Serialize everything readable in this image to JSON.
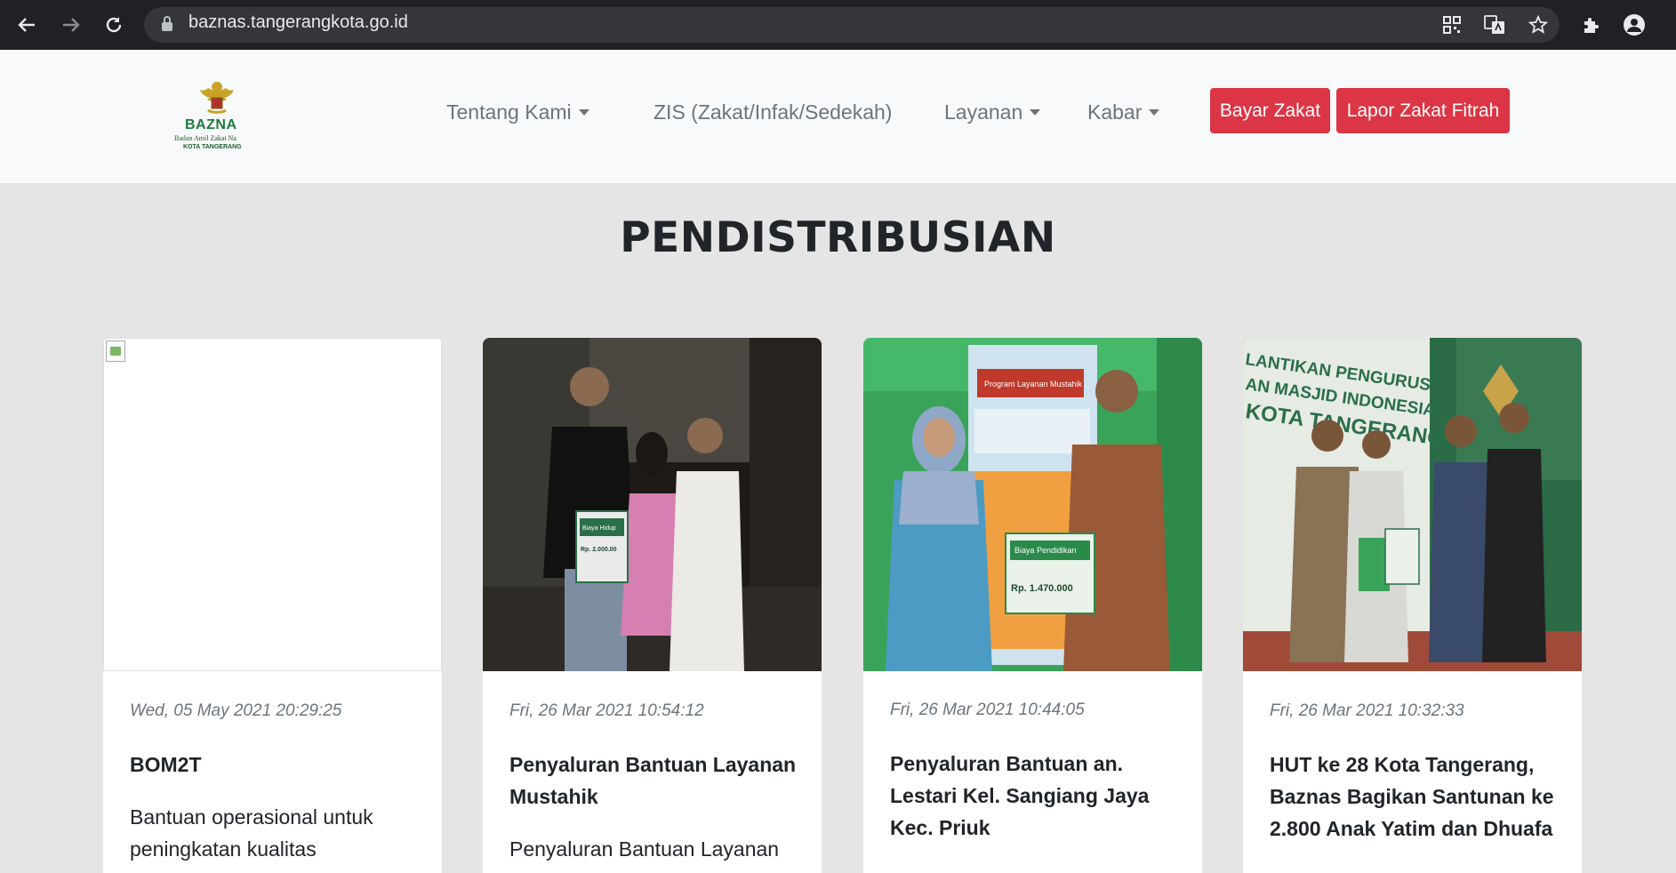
{
  "browser": {
    "url": "baznas.tangerangkota.go.id"
  },
  "header": {
    "logo": {
      "title": "BAZNA",
      "subtitle": "Badan Amil Zakat Na",
      "city": "KOTA TANGERANG"
    },
    "nav": [
      {
        "label": "Tentang Kami",
        "dropdown": true
      },
      {
        "label": "ZIS (Zakat/Infak/Sedekah)",
        "dropdown": false
      },
      {
        "label": "Layanan",
        "dropdown": true
      },
      {
        "label": "Kabar",
        "dropdown": true
      }
    ],
    "buttons": {
      "bayar_zakat": "Bayar Zakat",
      "lapor_zakat": "Lapor Zakat Fitrah"
    }
  },
  "section": {
    "title": "PENDISTRIBUSIAN"
  },
  "cards": [
    {
      "date": "Wed, 05 May 2021 20:29:25",
      "title": "BOM2T",
      "text": "Bantuan operasional untuk peningkatan kualitas"
    },
    {
      "date": "Fri, 26 Mar 2021 10:54:12",
      "title": "Penyaluran Bantuan Layanan Mustahik",
      "text": "Penyaluran Bantuan Layanan"
    },
    {
      "date": "Fri, 26 Mar 2021 10:44:05",
      "title": "Penyaluran Bantuan an. Lestari Kel. Sangiang Jaya Kec. Priuk",
      "text": ""
    },
    {
      "date": "Fri, 26 Mar 2021 10:32:33",
      "title": "HUT ke 28 Kota Tangerang, Baznas Bagikan Santunan ke 2.800 Anak Yatim dan Dhuafa",
      "text": ""
    }
  ],
  "photo_text": {
    "card2_sign": "Biaya Hidup",
    "card2_amount": "Rp. 2.000.00",
    "card3_banner": "Program Layanan Mustahik",
    "card3_sign": "Biaya Pendidikan",
    "card3_amount": "Rp. 1.470.000",
    "card4_banner_1": "LANTIKAN PENGURUS",
    "card4_banner_2": "AN MASJID INDONESIA",
    "card4_banner_3": "KOTA TANGERANG"
  },
  "colors": {
    "brand_red": "#dc3545",
    "logo_green": "#1e7a3c"
  },
  "icons": [
    "back-arrow-icon",
    "forward-arrow-icon",
    "reload-icon",
    "lock-icon",
    "qr-code-icon",
    "translate-icon",
    "star-icon",
    "extensions-icon",
    "profile-icon",
    "caret-down-icon",
    "garuda-emblem-icon",
    "broken-image-icon"
  ]
}
